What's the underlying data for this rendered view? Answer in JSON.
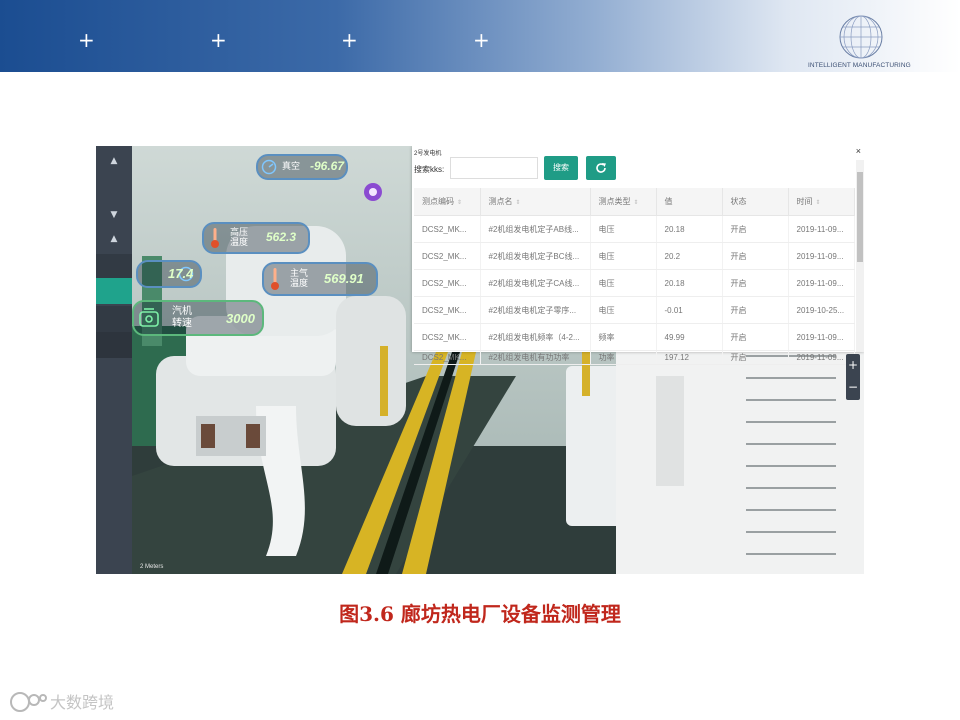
{
  "slide": {
    "header_plus": [
      "+",
      "+",
      "+",
      "+"
    ],
    "brand_label": "INTELLIGENT MANUFACTURING",
    "caption": "图3.6 廊坊热电厂设备监测管理",
    "watermark": "大数跨境",
    "colors": {
      "header_dark": "#1b4d91",
      "caption": "#c0271c",
      "accent_button": "#1f9c86"
    }
  },
  "scene": {
    "hud_tags": [
      {
        "label": "真空",
        "value": "-96.67",
        "icon": "gauge-icon"
      },
      {
        "label": "高压\n温度",
        "value": "562.3",
        "icon": "thermometer-icon"
      },
      {
        "label": "主气\n温度",
        "value": "569.91",
        "icon": "thermometer-icon"
      },
      {
        "label": "",
        "value": "17.4",
        "icon": "gauge-icon"
      },
      {
        "label": "汽机\n转速",
        "value": "3000",
        "icon": "turbine-icon"
      }
    ],
    "scale_label": "2 Meters",
    "zoom_in": "+",
    "zoom_out": "−"
  },
  "panel": {
    "title": "2号发电机",
    "close": "×",
    "search_label": "搜索kks:",
    "search_value": "",
    "search_button": "搜索",
    "refresh_icon": "refresh-icon",
    "columns": [
      "测点编码",
      "测点名",
      "测点类型",
      "值",
      "状态",
      "时间"
    ],
    "rows": [
      [
        "DCS2_MK...",
        "#2机组发电机定子AB线...",
        "电压",
        "20.18",
        "开启",
        "2019-11-09..."
      ],
      [
        "DCS2_MK...",
        "#2机组发电机定子BC线...",
        "电压",
        "20.2",
        "开启",
        "2019-11-09..."
      ],
      [
        "DCS2_MK...",
        "#2机组发电机定子CA线...",
        "电压",
        "20.18",
        "开启",
        "2019-11-09..."
      ],
      [
        "DCS2_MK...",
        "#2机组发电机定子零序...",
        "电压",
        "-0.01",
        "开启",
        "2019-10-25..."
      ],
      [
        "DCS2_MK...",
        "#2机组发电机频率（4-2...",
        "频率",
        "49.99",
        "开启",
        "2019-11-09..."
      ],
      [
        "DCS2_MK...",
        "#2机组发电机有功功率",
        "功率",
        "197.12",
        "开启",
        "2019-11-09..."
      ]
    ]
  }
}
